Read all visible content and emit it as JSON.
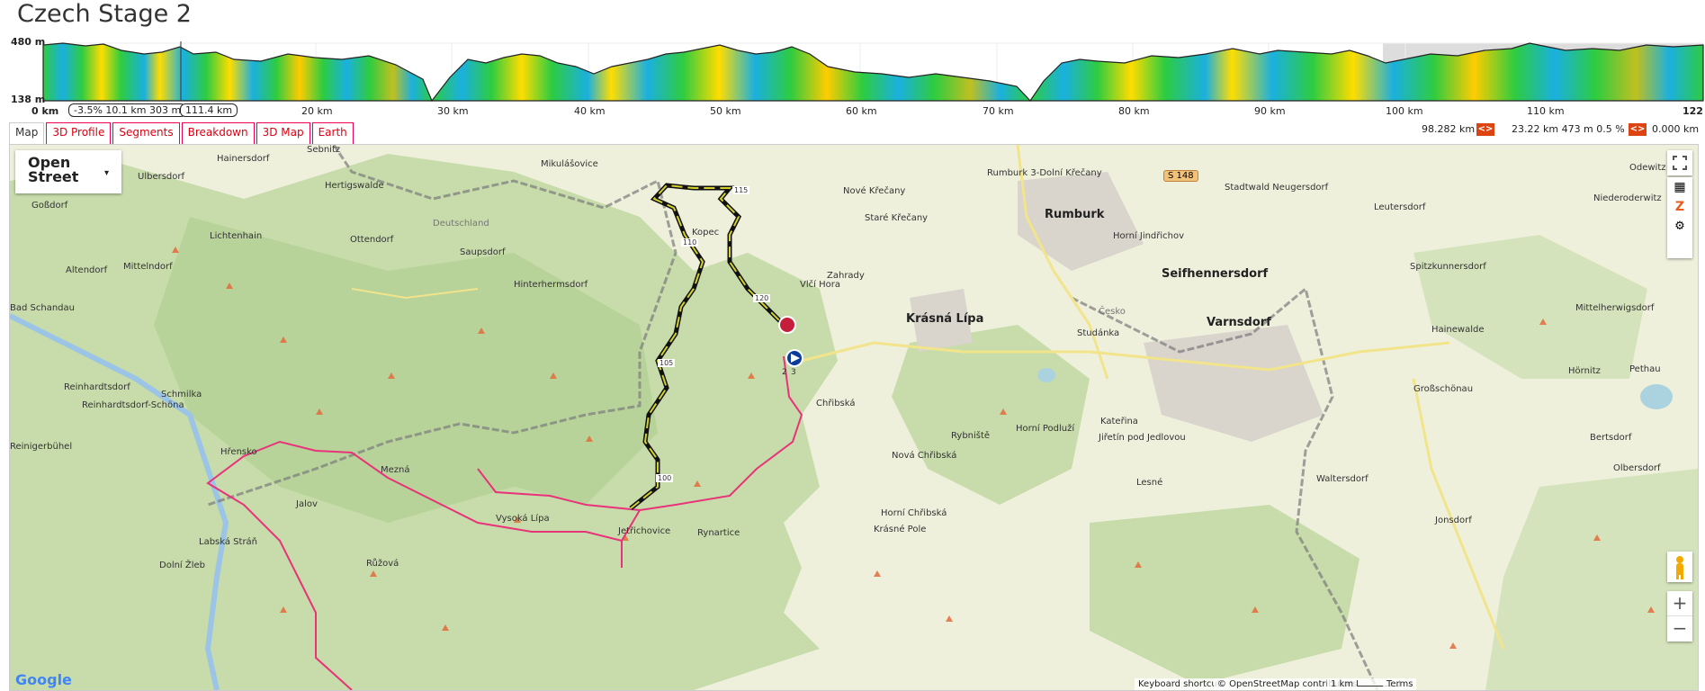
{
  "title": "Czech Stage 2",
  "profile": {
    "y_max": "480 m",
    "y_min": "138 m",
    "x_labels": [
      "0 km",
      "10 km",
      "20 km",
      "30 km",
      "40 km",
      "50 km",
      "60 km",
      "70 km",
      "80 km",
      "90 km",
      "100 km",
      "110 km",
      "122"
    ],
    "segment_tag": "-3.5% 10.1 km 303 m",
    "position_tag": "111.4 km"
  },
  "tabs": [
    "Map",
    "3D Profile",
    "Segments",
    "Breakdown",
    "3D Map",
    "Earth"
  ],
  "stats": {
    "left_km": "98.282 km",
    "segment": "23.22 km 473 m 0.5 %",
    "right_km": "0.000 km",
    "arrows": "<>"
  },
  "map": {
    "layer_selector": "Open Street",
    "places": [
      {
        "name": "Sebnitz"
      },
      {
        "name": "Hainersdorf"
      },
      {
        "name": "Mikulášovice"
      },
      {
        "name": "Ulbersdorf"
      },
      {
        "name": "Hertigswalde"
      },
      {
        "name": "Goßdorf"
      },
      {
        "name": "Lichtenhain"
      },
      {
        "name": "Ottendorf"
      },
      {
        "name": "Saupsdorf"
      },
      {
        "name": "Deutschland"
      },
      {
        "name": "Altendorf"
      },
      {
        "name": "Mittelndorf"
      },
      {
        "name": "Hinterhermsdorf"
      },
      {
        "name": "Kopec"
      },
      {
        "name": "Nové Křečany"
      },
      {
        "name": "Staré Křečany"
      },
      {
        "name": "Rumburk 3-Dolní Křečany"
      },
      {
        "name": "Rumburk"
      },
      {
        "name": "Horní Jindřichov"
      },
      {
        "name": "Stadtwald Neugersdorf"
      },
      {
        "name": "Leutersdorf"
      },
      {
        "name": "Odewitz"
      },
      {
        "name": "Niederoderwitz"
      },
      {
        "name": "Seifhennersdorf"
      },
      {
        "name": "Spitzkunnersdorf"
      },
      {
        "name": "Zahrady"
      },
      {
        "name": "Vlčí Hora"
      },
      {
        "name": "Krásná Lípa"
      },
      {
        "name": "Krásné Pole"
      },
      {
        "name": "Varnsdorf"
      },
      {
        "name": "Studánka"
      },
      {
        "name": "Mittelherwigsdorf"
      },
      {
        "name": "Hainewalde"
      },
      {
        "name": "Hörnitz"
      },
      {
        "name": "Pethau"
      },
      {
        "name": "Großschönau"
      },
      {
        "name": "Reinhardtsdorf"
      },
      {
        "name": "Reinhardtsdorf-Schöna"
      },
      {
        "name": "Schmilka"
      },
      {
        "name": "Chřibská"
      },
      {
        "name": "Rybniště"
      },
      {
        "name": "Kateřina"
      },
      {
        "name": "Horní Podluží"
      },
      {
        "name": "Jiřetín pod Jedlovou"
      },
      {
        "name": "Bertsdorf"
      },
      {
        "name": "Hřensko"
      },
      {
        "name": "Mezná"
      },
      {
        "name": "Nová Chřibská"
      },
      {
        "name": "Waltersdorf"
      },
      {
        "name": "Olbersdorf"
      },
      {
        "name": "Lesné"
      },
      {
        "name": "Jetřichovice"
      },
      {
        "name": "Rynartice"
      },
      {
        "name": "Horní Chřibská"
      },
      {
        "name": "Vysoká Lípa"
      },
      {
        "name": "Jonsdorf"
      },
      {
        "name": "Labská Stráň"
      },
      {
        "name": "Jalov"
      },
      {
        "name": "Dolní Žleb"
      },
      {
        "name": "Růžová"
      },
      {
        "name": "Bad Schandau"
      },
      {
        "name": "Reinigerbühel"
      },
      {
        "name": "Česko"
      }
    ],
    "road_badge": "S 148",
    "km_markers": [
      "115",
      "110",
      "120",
      "105",
      "100",
      "2",
      "3"
    ],
    "attribution": {
      "google": "Google",
      "shortcuts": "Keyboard shortcuts",
      "osm": "© OpenStreetMap contributors",
      "scale": "1 km",
      "terms": "Terms"
    },
    "zoom_in": "+",
    "zoom_out": "−"
  },
  "colors": {
    "route_pink": "#e8337a",
    "route_dark": "#1a1a1a",
    "tab_red": "#dd1133",
    "forest": "#c3d9a6",
    "field": "#eef0dc"
  }
}
